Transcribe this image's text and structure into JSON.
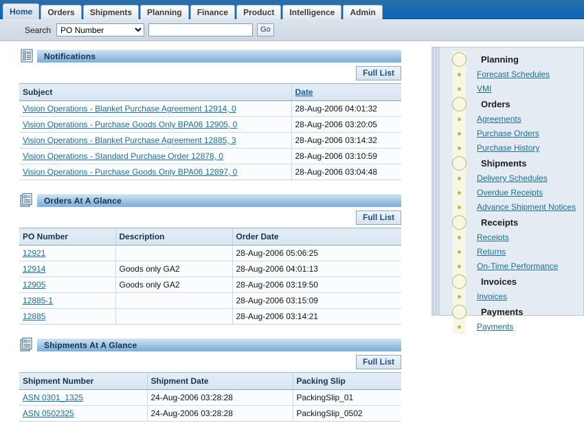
{
  "header": {
    "tabs": [
      {
        "label": "Home",
        "active": true
      },
      {
        "label": "Orders",
        "active": false
      },
      {
        "label": "Shipments",
        "active": false
      },
      {
        "label": "Planning",
        "active": false
      },
      {
        "label": "Finance",
        "active": false
      },
      {
        "label": "Product",
        "active": false
      },
      {
        "label": "Intelligence",
        "active": false
      },
      {
        "label": "Admin",
        "active": false
      }
    ]
  },
  "search": {
    "label": "Search",
    "selected_option": "PO Number",
    "options": [
      "PO Number"
    ],
    "input_value": "",
    "placeholder": "",
    "go_label": "Go"
  },
  "sections": [
    {
      "id": "notifications",
      "title": "Notifications",
      "icon": "list-document-icon",
      "full_list_label": "Full List",
      "columns": [
        {
          "label": "Subject",
          "sortable": false
        },
        {
          "label": "Date",
          "sortable": true
        }
      ],
      "rows": [
        {
          "subject": "Vision Operations - Blanket Purchase Agreement 12914, 0",
          "date": "28-Aug-2006 04:01:32"
        },
        {
          "subject": "Vision Operations - Purchase Goods Only BPA06 12905, 0",
          "date": "28-Aug-2006 03:20:05"
        },
        {
          "subject": "Vision Operations - Blanket Purchase Agreement 12885, 3",
          "date": "28-Aug-2006 03:14:32"
        },
        {
          "subject": "Vision Operations - Standard Purchase Order 12878, 0",
          "date": "28-Aug-2006 03:10:59"
        },
        {
          "subject": "Vision Operations - Purchase Goods Only BPA06 12897, 0",
          "date": "28-Aug-2006 03:04:48"
        }
      ]
    },
    {
      "id": "orders-at-a-glance",
      "title": "Orders At A Glance",
      "icon": "stacked-documents-icon",
      "full_list_label": "Full List",
      "columns": [
        {
          "label": "PO Number",
          "sortable": false
        },
        {
          "label": "Description",
          "sortable": false
        },
        {
          "label": "Order Date",
          "sortable": false
        }
      ],
      "rows": [
        {
          "po_number": "12921",
          "description": "",
          "order_date": "28-Aug-2006 05:06:25"
        },
        {
          "po_number": "12914",
          "description": "Goods only GA2",
          "order_date": "28-Aug-2006 04:01:13"
        },
        {
          "po_number": "12905",
          "description": "Goods only GA2",
          "order_date": "28-Aug-2006 03:19:50"
        },
        {
          "po_number": "12885-1",
          "description": "",
          "order_date": "28-Aug-2006 03:15:09"
        },
        {
          "po_number": "12885",
          "description": "",
          "order_date": "28-Aug-2006 03:14:21"
        }
      ]
    },
    {
      "id": "shipments-at-a-glance",
      "title": "Shipments At A Glance",
      "icon": "stacked-documents-icon",
      "full_list_label": "Full List",
      "columns": [
        {
          "label": "Shipment Number",
          "sortable": false
        },
        {
          "label": "Shipment Date",
          "sortable": false
        },
        {
          "label": "Packing Slip",
          "sortable": false
        }
      ],
      "rows": [
        {
          "shipment_number": "ASN 0301_1325",
          "shipment_date": "24-Aug-2006 03:28:28",
          "packing_slip": "PackingSlip_01"
        },
        {
          "shipment_number": "ASN 0502325",
          "shipment_date": "24-Aug-2006 03:28:28",
          "packing_slip": "PackingSlip_0502"
        }
      ]
    }
  ],
  "sidebar": {
    "items": [
      {
        "label": "Planning",
        "type": "group"
      },
      {
        "label": "Forecast Schedules",
        "type": "link"
      },
      {
        "label": "VMI",
        "type": "link"
      },
      {
        "label": "Orders",
        "type": "group"
      },
      {
        "label": "Agreements",
        "type": "link"
      },
      {
        "label": "Purchase Orders",
        "type": "link"
      },
      {
        "label": "Purchase History",
        "type": "link"
      },
      {
        "label": "Shipments",
        "type": "group"
      },
      {
        "label": "Delivery Schedules",
        "type": "link"
      },
      {
        "label": "Overdue Receipts",
        "type": "link"
      },
      {
        "label": "Advance Shipment Notices",
        "type": "link"
      },
      {
        "label": "Receipts",
        "type": "group"
      },
      {
        "label": "Receipts",
        "type": "link"
      },
      {
        "label": "Returns",
        "type": "link"
      },
      {
        "label": "On-Time Performance",
        "type": "link"
      },
      {
        "label": "Invoices",
        "type": "group"
      },
      {
        "label": "Invoices",
        "type": "link"
      },
      {
        "label": "Payments",
        "type": "group"
      },
      {
        "label": "Payments",
        "type": "link"
      }
    ]
  },
  "colors": {
    "topbar_blue": "#1569b4",
    "active_tab_text": "#16508f",
    "link": "#1c6e92",
    "section_header_blue": "#8fb9dd",
    "sidebar_bg": "#e4ebf3",
    "rail_cream": "#f7f7e4",
    "rail_dot": "#b7b96a"
  }
}
